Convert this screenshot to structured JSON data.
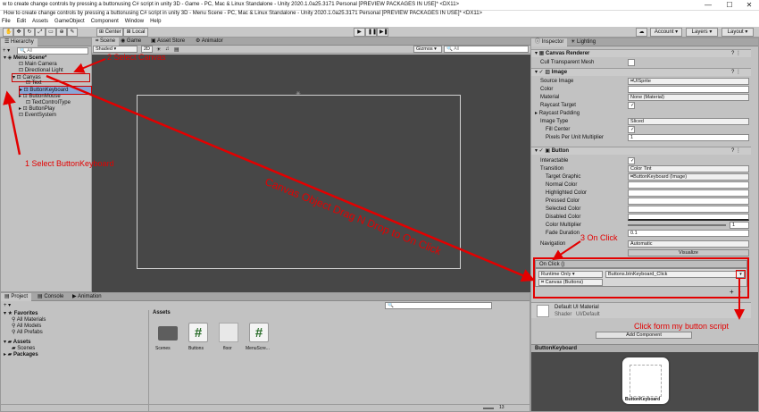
{
  "window": {
    "title1": "w to create change controls by pressing a buttonusing C# script in unity 3D - Game - PC, Mac & Linux Standalone - Unity 2020.1.0a25.3171 Personal [PREVIEW PACKAGES IN USE]* <DX11>",
    "title2": "How to create change controls by pressing a buttonusing C# script in unity 3D - Menu Scene - PC, Mac & Linux Standalone - Unity 2020.1.0a25.3171 Personal [PREVIEW PACKAGES IN USE]* <DX11>",
    "minimize": "—",
    "maximize": "☐",
    "close": "✕"
  },
  "menu": [
    "File",
    "Edit",
    "Assets",
    "GameObject",
    "Component",
    "Window",
    "Help"
  ],
  "toolbar": {
    "center": "Center",
    "local": "Local",
    "account": "Account",
    "layers": "Layers",
    "layout": "Layout",
    "play": "▶",
    "pause": "❚❚",
    "step": "▶❚"
  },
  "hierarchy": {
    "tab": "Hierarchy",
    "search_placeholder": "All",
    "items": [
      "Menu Scene*",
      "Main Camera",
      "Directional Light",
      "Canvas",
      "Text",
      "ButtonKeyboard",
      "ButtonMouse",
      "TextControlType",
      "ButtonPlay",
      "EventSystem"
    ]
  },
  "scene": {
    "tabs": [
      "Scene",
      "Game",
      "Asset Store",
      "Animator"
    ],
    "shading": "Shaded",
    "mode2d": "2D",
    "gizmos": "Gizmos",
    "search_placeholder": "All"
  },
  "inspector": {
    "tabs": [
      "Inspector",
      "Lighting"
    ],
    "canvas_renderer": "Canvas Renderer",
    "cull_mesh": "Cull Transparent Mesh",
    "image_header": "Image",
    "image_rows": [
      {
        "label": "Source Image",
        "value": "UISprite"
      },
      {
        "label": "Color",
        "value": ""
      },
      {
        "label": "Material",
        "value": "None (Material)"
      },
      {
        "label": "Raycast Target",
        "value": "✓"
      },
      {
        "label": "Raycast Padding",
        "value": ""
      },
      {
        "label": "Image Type",
        "value": "Sliced"
      },
      {
        "label": "Fill Center",
        "value": "✓"
      },
      {
        "label": "Pixels Per Unit Multiplier",
        "value": "1"
      }
    ],
    "button_header": "Button",
    "button_rows": [
      {
        "label": "Interactable",
        "value": "✓"
      },
      {
        "label": "Transition",
        "value": "Color Tint"
      },
      {
        "label": "Target Graphic",
        "value": "ButtonKeyboard (Image)"
      },
      {
        "label": "Normal Color",
        "value": ""
      },
      {
        "label": "Highlighted Color",
        "value": ""
      },
      {
        "label": "Pressed Color",
        "value": ""
      },
      {
        "label": "Selected Color",
        "value": ""
      },
      {
        "label": "Disabled Color",
        "value": ""
      },
      {
        "label": "Color Multiplier",
        "value": "1"
      },
      {
        "label": "Fade Duration",
        "value": "0.1"
      },
      {
        "label": "Navigation",
        "value": "Automatic"
      }
    ],
    "visualize": "Visualize",
    "onclick_header": "On Click ()",
    "runtime": "Runtime Only",
    "function": "Buttons.btnKeyboard_Click",
    "object": "Canvas (Buttons)",
    "plus": "+",
    "minus": "-",
    "material_name": "Default UI Material",
    "shader_label": "Shader",
    "shader_value": "UI/Default",
    "add_component": "Add Component",
    "preview_label": "ButtonKeyboard",
    "preview_text": "ButtonKeyboard"
  },
  "project": {
    "tabs": [
      "Project",
      "Console",
      "Animation"
    ],
    "tree": [
      "Favorites",
      "All Materials",
      "All Models",
      "All Prefabs",
      "Assets",
      "Scenes",
      "Packages"
    ],
    "breadcrumb": "Assets",
    "assets": [
      {
        "name": "Scenes",
        "icon": "folder-icon"
      },
      {
        "name": "Buttons",
        "icon": "csharp-icon"
      },
      {
        "name": "floor",
        "icon": "texture-icon"
      },
      {
        "name": "MenuScre...",
        "icon": "csharp-icon"
      }
    ],
    "count": "13"
  },
  "annotations": {
    "a1": "1 Select ButtonKeyboard",
    "a2": "2 Select Canvas",
    "a3": "Canvas Object Drag N Drop to On Click",
    "a4": "3 On Click",
    "a5": "Click form my button script"
  },
  "colors": {
    "annotation": "#e30000",
    "selection": "#8aa6d6",
    "scene_bg": "#474747"
  }
}
